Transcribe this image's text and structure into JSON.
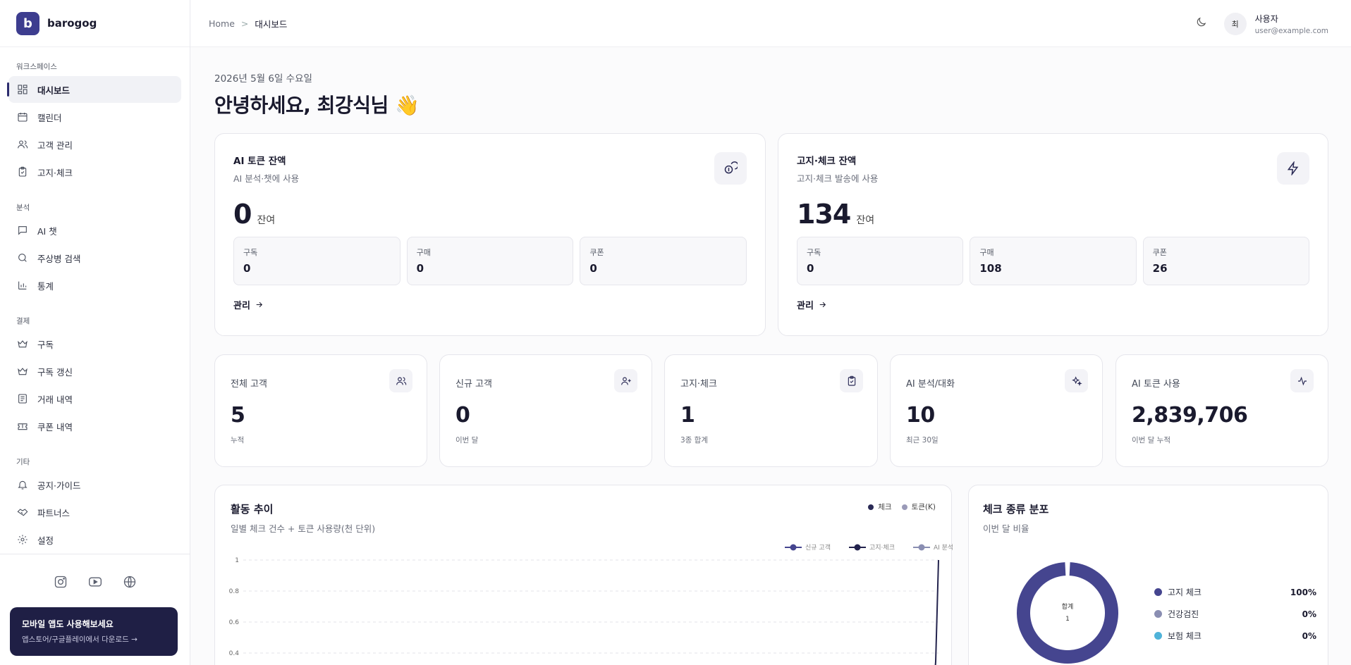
{
  "brand": {
    "name": "barogog",
    "logo_glyph": "b"
  },
  "sidebar": {
    "sections": [
      {
        "title": "워크스페이스",
        "items": [
          {
            "label": "대시보드",
            "icon": "dashboard-icon",
            "active": true
          },
          {
            "label": "캘린더",
            "icon": "calendar-icon"
          },
          {
            "label": "고객 관리",
            "icon": "users-icon"
          },
          {
            "label": "고지·체크",
            "icon": "clipboard-check-icon"
          }
        ]
      },
      {
        "title": "분석",
        "items": [
          {
            "label": "AI 챗",
            "icon": "chat-icon"
          },
          {
            "label": "주상병 검색",
            "icon": "search-icon"
          },
          {
            "label": "통계",
            "icon": "bar-chart-icon"
          }
        ]
      },
      {
        "title": "결제",
        "items": [
          {
            "label": "구독",
            "icon": "crown-icon"
          },
          {
            "label": "구독 갱신",
            "icon": "crown-icon"
          },
          {
            "label": "거래 내역",
            "icon": "receipt-icon"
          },
          {
            "label": "쿠폰 내역",
            "icon": "ticket-icon"
          }
        ]
      },
      {
        "title": "기타",
        "items": [
          {
            "label": "공지·가이드",
            "icon": "bell-icon"
          },
          {
            "label": "파트너스",
            "icon": "handshake-icon"
          },
          {
            "label": "설정",
            "icon": "gear-icon"
          }
        ]
      }
    ],
    "socials": [
      "instagram-icon",
      "youtube-icon",
      "globe-icon"
    ],
    "banner": {
      "title": "모바일 앱도 사용해보세요",
      "subtitle": "앱스토어/구글플레이에서 다운로드 →"
    }
  },
  "header": {
    "breadcrumb": {
      "home": "Home",
      "sep": ">",
      "current": "대시보드"
    },
    "avatar_initial": "최",
    "user_name": "사용자",
    "user_email": "user@example.com"
  },
  "greeting": {
    "date": "2026년 5월 6일 수요일",
    "title": "안녕하세요, 최강식님 👋"
  },
  "balances": [
    {
      "title": "AI 토큰 잔액",
      "subtitle": "AI 분석·챗에 사용",
      "value": "0",
      "unit": "잔여",
      "icon": "coins-icon",
      "boxes": [
        {
          "label": "구독",
          "value": "0"
        },
        {
          "label": "구매",
          "value": "0"
        },
        {
          "label": "쿠폰",
          "value": "0"
        }
      ],
      "link": "관리"
    },
    {
      "title": "고지·체크 잔액",
      "subtitle": "고지·체크 발송에 사용",
      "value": "134",
      "unit": "잔여",
      "icon": "lightning-icon",
      "boxes": [
        {
          "label": "구독",
          "value": "0"
        },
        {
          "label": "구매",
          "value": "108"
        },
        {
          "label": "쿠폰",
          "value": "26"
        }
      ],
      "link": "관리"
    }
  ],
  "stats": [
    {
      "label": "전체 고객",
      "value": "5",
      "note": "누적",
      "icon": "users-icon"
    },
    {
      "label": "신규 고객",
      "value": "0",
      "note": "이번 달",
      "icon": "user-plus-icon"
    },
    {
      "label": "고지·체크",
      "value": "1",
      "note": "3종 합계",
      "icon": "clipboard-check-icon"
    },
    {
      "label": "AI 분석/대화",
      "value": "10",
      "note": "최근 30일",
      "icon": "sparkles-icon"
    },
    {
      "label": "AI 토큰 사용",
      "value": "2,839,706",
      "note": "이번 달 누적",
      "icon": "activity-icon"
    }
  ],
  "activity": {
    "title": "활동 추이",
    "subtitle": "일별 체크 건수 + 토큰 사용량(천 단위)",
    "legend_top": [
      {
        "label": "체크",
        "color": "#2a2a55"
      },
      {
        "label": "토큰(K)",
        "color": "#9a9ab8"
      }
    ]
  },
  "distribution": {
    "title": "체크 종류 분포",
    "subtitle": "이번 달 비율",
    "center_label": "합계",
    "center_value": "1",
    "items": [
      {
        "label": "고지 체크",
        "pct": "100%",
        "color": "#45458f"
      },
      {
        "label": "건강검진",
        "pct": "0%",
        "color": "#8a8eb2"
      },
      {
        "label": "보험 체크",
        "pct": "0%",
        "color": "#4fb3d9"
      }
    ]
  },
  "chart_data": {
    "type": "line",
    "series": [
      {
        "name": "신규 고객",
        "color": "#45458f"
      },
      {
        "name": "고지·체크",
        "color": "#23234d"
      },
      {
        "name": "AI 분석",
        "color": "#8a8eb2"
      }
    ],
    "y_ticks": [
      "1",
      "0.8",
      "0.6",
      "0.4"
    ],
    "ylim": [
      0,
      1
    ],
    "grid": true,
    "legend_placement": "top-right"
  }
}
